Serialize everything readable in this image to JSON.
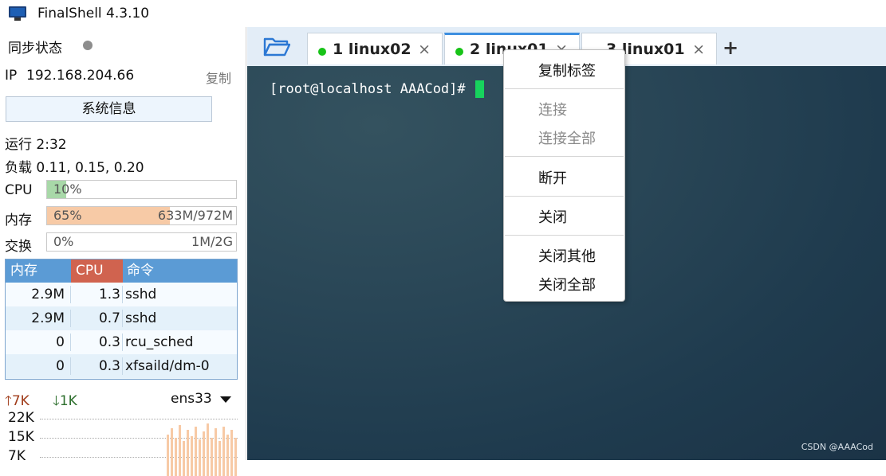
{
  "window": {
    "title": "FinalShell 4.3.10"
  },
  "sidebar": {
    "sync_label": "同步状态",
    "ip_label": "IP",
    "ip_value": "192.168.204.66",
    "copy_label": "复制",
    "sysinfo_button": "系统信息",
    "uptime": "运行 2:32",
    "load": "负载 0.11, 0.15, 0.20",
    "meters": {
      "cpu": {
        "label": "CPU",
        "percent_text": "10%",
        "fraction": 0.1,
        "amount": "",
        "color": "#a8d8a8"
      },
      "mem": {
        "label": "内存",
        "percent_text": "65%",
        "fraction": 0.65,
        "amount": "633M/972M",
        "color": "#f7caa6"
      },
      "swap": {
        "label": "交换",
        "percent_text": "0%",
        "fraction": 0.0,
        "amount": "1M/2G",
        "color": "#cfcfcf"
      }
    },
    "process_table": {
      "headers": {
        "mem": "内存",
        "cpu": "CPU",
        "cmd": "命令"
      },
      "rows": [
        {
          "mem": "2.9M",
          "cpu": "1.3",
          "cmd": "sshd"
        },
        {
          "mem": "2.9M",
          "cpu": "0.7",
          "cmd": "sshd"
        },
        {
          "mem": "0",
          "cpu": "0.3",
          "cmd": "rcu_sched"
        },
        {
          "mem": "0",
          "cpu": "0.3",
          "cmd": "xfsaild/dm-0"
        }
      ]
    },
    "network": {
      "up": "7K",
      "down": "1K",
      "interface": "ens33",
      "yticks": [
        "22K",
        "15K",
        "7K"
      ]
    }
  },
  "tabs": [
    {
      "label": "1 linux02",
      "close": "×"
    },
    {
      "label": "2 linux01",
      "close": "×"
    },
    {
      "label": "3 linux01",
      "close": "×"
    }
  ],
  "add_tab": "+",
  "terminal": {
    "prompt": "[root@localhost AAACod]# ",
    "watermark": "CSDN @AAACod"
  },
  "context_menu": {
    "items": [
      {
        "label": "复制标签",
        "enabled": true
      },
      {
        "label": "连接",
        "enabled": false
      },
      {
        "label": "连接全部",
        "enabled": false
      },
      {
        "label": "断开",
        "enabled": true
      },
      {
        "label": "关闭",
        "enabled": true
      },
      {
        "label": "关闭其他",
        "enabled": true
      },
      {
        "label": "关闭全部",
        "enabled": true
      }
    ]
  },
  "colors": {
    "accent": "#3d8fe0",
    "status_online": "#17c317",
    "cursor": "#17d35d",
    "table_header": "#5b9bd5",
    "table_header_active": "#d0634f",
    "net_up": "#a03c1a",
    "net_down": "#2c6e2c"
  }
}
